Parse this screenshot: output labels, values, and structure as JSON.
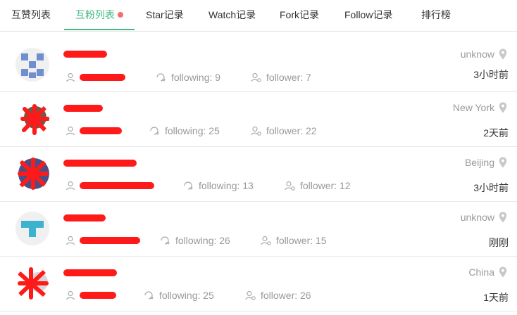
{
  "tabs": [
    {
      "label": "互赞列表",
      "active": false
    },
    {
      "label": "互粉列表",
      "active": true,
      "has_dot": true
    },
    {
      "label": "Star记录",
      "active": false
    },
    {
      "label": "Watch记录",
      "active": false
    },
    {
      "label": "Fork记录",
      "active": false
    },
    {
      "label": "Follow记录",
      "active": false
    },
    {
      "label": "排行榜",
      "active": false
    }
  ],
  "colors": {
    "accent": "#42b983",
    "dot": "#f56c6c",
    "redaction": "#ff1a1a",
    "muted": "#999999"
  },
  "users": [
    {
      "following": "following: 9",
      "follower": "follower: 7",
      "location": "unknow",
      "time": "3小时前",
      "avatar": "identicon-blue"
    },
    {
      "following": "following: 25",
      "follower": "follower: 22",
      "location": "New York",
      "time": "2天前",
      "avatar": "photo-redacted"
    },
    {
      "following": "following: 13",
      "follower": "follower: 12",
      "location": "Beijing",
      "time": "3小时前",
      "avatar": "photo-redacted"
    },
    {
      "following": "following: 26",
      "follower": "follower: 15",
      "location": "unknow",
      "time": "刚刚",
      "avatar": "identicon-teal"
    },
    {
      "following": "following: 25",
      "follower": "follower: 26",
      "location": "China",
      "time": "1天前",
      "avatar": "photo-redacted"
    }
  ]
}
